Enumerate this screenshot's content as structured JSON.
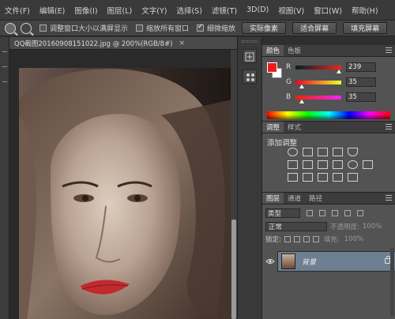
{
  "menu": [
    "文件(F)",
    "编辑(E)",
    "图像(I)",
    "图层(L)",
    "文字(Y)",
    "选择(S)",
    "滤镜(T)",
    "3D(D)",
    "视图(V)",
    "窗口(W)",
    "帮助(H)"
  ],
  "options": {
    "resize_windows_label": "调整窗口大小以满屏显示",
    "zoom_all_label": "缩放所有窗口",
    "scrubby_zoom_label": "细微缩放",
    "actual_pixels_button": "实际像素",
    "fit_screen_button": "适合屏幕",
    "fill_screen_button": "填充屏幕"
  },
  "document": {
    "tab_title": "QQ截图20160908151022.jpg @ 200%(RGB/8#)",
    "close_glyph": "×"
  },
  "color_panel": {
    "tabs": [
      "颜色",
      "色板"
    ],
    "foreground": "#ef1c1c",
    "background": "#ffffff",
    "channels": [
      {
        "label": "R",
        "value": "239"
      },
      {
        "label": "G",
        "value": "35"
      },
      {
        "label": "B",
        "value": "35"
      }
    ]
  },
  "adjustments_panel": {
    "tabs": [
      "调整",
      "样式"
    ],
    "title": "添加调整"
  },
  "layers_panel": {
    "tabs": [
      "图层",
      "通道",
      "路径"
    ],
    "kind": "类型",
    "blend_mode": "正常",
    "opacity_label": "不透明度:",
    "opacity_value": "100%",
    "lock_label": "锁定:",
    "fill_label": "填充:",
    "fill_value": "100%",
    "layer_name": "背景"
  }
}
